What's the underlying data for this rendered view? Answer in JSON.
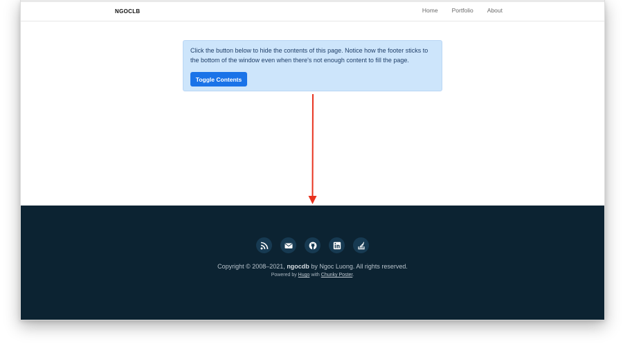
{
  "navbar": {
    "brand": "NGOCLB",
    "links": [
      "Home",
      "Portfolio",
      "About"
    ]
  },
  "alert": {
    "text": "Click the button below to hide the contents of this page. Notice how the footer sticks to the bottom of the window even when there's not enough content to fill the page.",
    "button_label": "Toggle Contents"
  },
  "footer": {
    "social_icons": [
      "rss-icon",
      "email-icon",
      "github-icon",
      "linkedin-icon",
      "stack-overflow-icon"
    ],
    "copyright_prefix": "Copyright © 2008–2021,",
    "copyright_site": "ngocdb",
    "copyright_suffix": "by Ngoc Luong. All rights reserved.",
    "powered_prefix": "Powered by",
    "powered_hugo": "Hugo",
    "powered_with": "with",
    "powered_theme": "Chunky Poster",
    "powered_end": "."
  },
  "colors": {
    "footer_bg": "#0c2332",
    "alert_bg": "#cde5fb",
    "button_bg": "#1a73e8",
    "arrow": "#e8321e"
  }
}
